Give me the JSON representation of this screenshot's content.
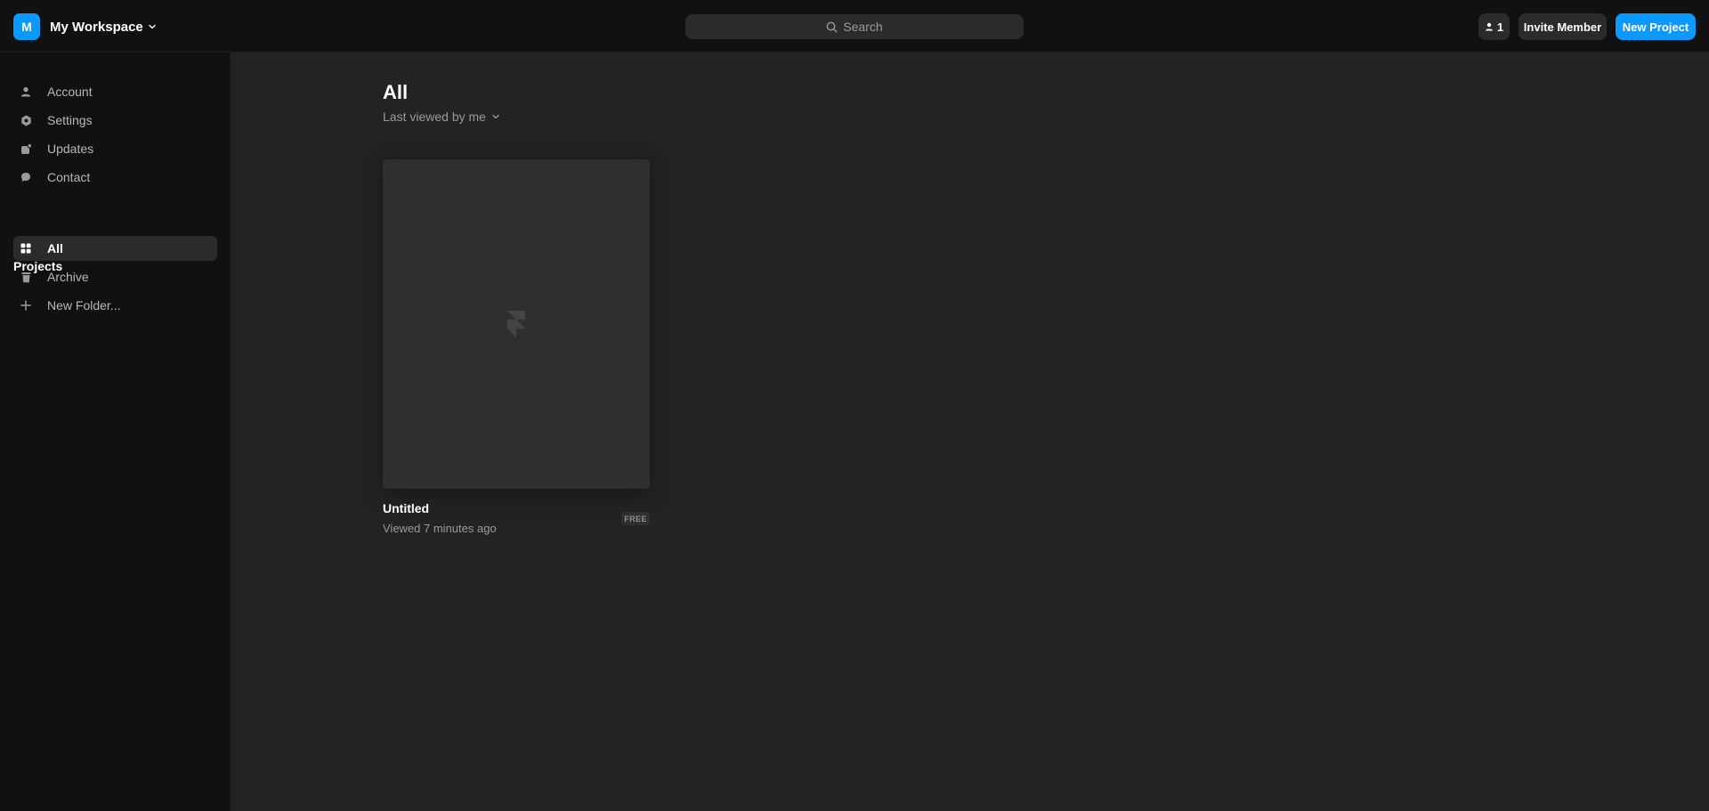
{
  "colors": {
    "accent": "#0a99ff",
    "background": "#232323",
    "sidebar": "#111111",
    "muted_text": "#9a9a9a"
  },
  "workspace": {
    "initial": "M",
    "name": "My Workspace"
  },
  "search": {
    "placeholder": "Search"
  },
  "header": {
    "member_count": "1",
    "invite_label": "Invite Member",
    "new_project_label": "New Project"
  },
  "sidebar": {
    "account_items": [
      {
        "label": "Account",
        "icon": "user-icon"
      },
      {
        "label": "Settings",
        "icon": "gear-icon"
      },
      {
        "label": "Updates",
        "icon": "updates-icon"
      },
      {
        "label": "Contact",
        "icon": "chat-bubble-icon"
      }
    ],
    "projects_title": "Projects",
    "project_items": [
      {
        "label": "All",
        "icon": "grid-icon",
        "active": true
      },
      {
        "label": "Archive",
        "icon": "trash-icon",
        "active": false
      },
      {
        "label": "New Folder...",
        "icon": "plus-icon",
        "active": false
      }
    ]
  },
  "main": {
    "title": "All",
    "sort_label": "Last viewed by me",
    "projects": [
      {
        "title": "Untitled",
        "meta": "Viewed 7 minutes ago",
        "badge": "FREE",
        "thumbnail_icon": "framer-logo-icon"
      }
    ]
  }
}
